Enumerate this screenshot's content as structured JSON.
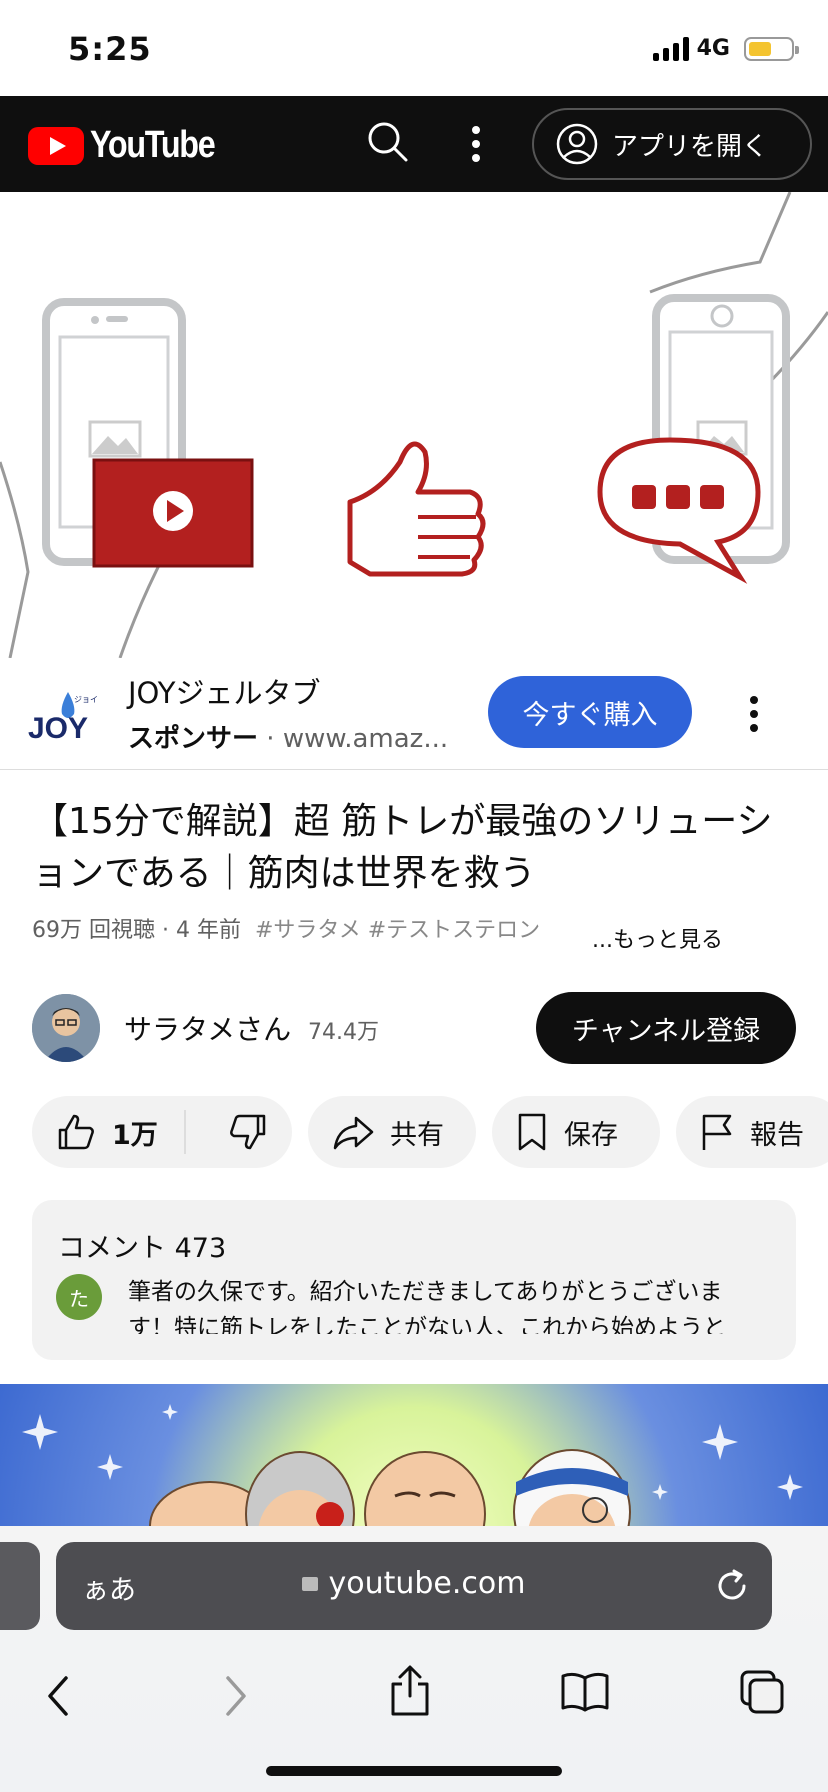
{
  "status_bar": {
    "time": "5:25",
    "network": "4G"
  },
  "header": {
    "logo_text": "YouTube",
    "open_app_label": "アプリを開く"
  },
  "sponsor": {
    "logo_text": "JOY",
    "logo_small": "ジョイ",
    "title": "JOYジェルタブ",
    "sponsor_label": "スポンサー",
    "separator": " · ",
    "url": "www.amaz...",
    "buy_label": "今すぐ購入"
  },
  "video": {
    "title": "【15分で解説】超 筋トレが最強のソリューションである｜筋肉は世界を救う",
    "meta": "69万 回視聴 · 4 年前",
    "tags": "#サラタメ #テストステロン",
    "more_label": "...もっと見る"
  },
  "channel": {
    "name": "サラタメさん",
    "subscribers": "74.4万",
    "subscribe_label": "チャンネル登録"
  },
  "actions": {
    "like_count": "1万",
    "share_label": "共有",
    "save_label": "保存",
    "report_label": "報告"
  },
  "comments": {
    "header": "コメント 473",
    "avatar_initial": "た",
    "text": "筆者の久保です。紹介いただきましてありがとうございます！特に筋トレをしたことがない人、これから始めようと"
  },
  "browser": {
    "text_size_label": "ぁあ",
    "url": "youtube.com"
  },
  "colors": {
    "brand_red": "#ff0000",
    "buy_blue": "#2f63d9",
    "ad_red": "#b3201f"
  }
}
